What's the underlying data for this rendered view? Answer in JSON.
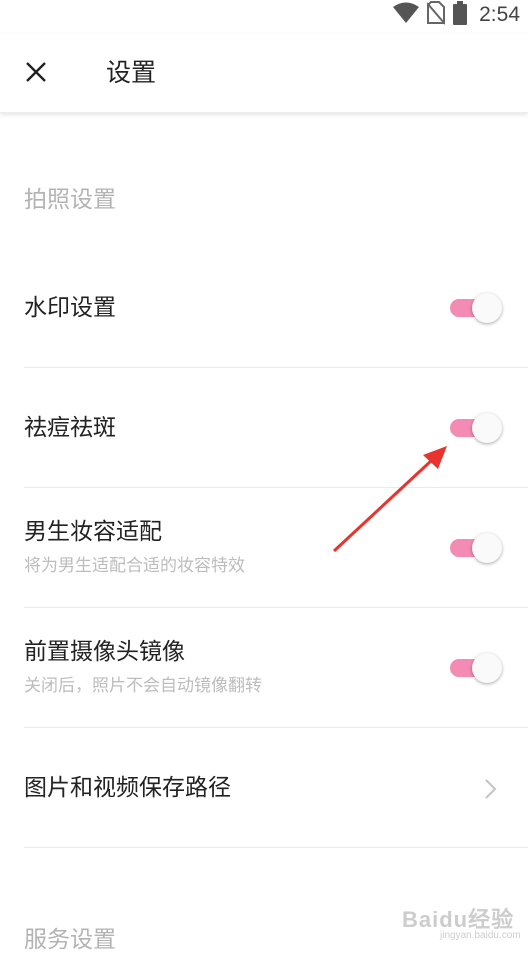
{
  "status_bar": {
    "time": "2:54",
    "icons": [
      "wifi-icon",
      "no-sim-icon",
      "battery-icon"
    ]
  },
  "app_bar": {
    "title": "设置",
    "close_icon": "close-icon"
  },
  "sections": {
    "photo": {
      "header": "拍照设置"
    },
    "service": {
      "header": "服务设置"
    }
  },
  "settings": [
    {
      "label": "水印设置",
      "sublabel": "",
      "type": "toggle",
      "on": true
    },
    {
      "label": "祛痘祛斑",
      "sublabel": "",
      "type": "toggle",
      "on": true
    },
    {
      "label": "男生妆容适配",
      "sublabel": "将为男生适配合适的妆容特效",
      "type": "toggle",
      "on": true
    },
    {
      "label": "前置摄像头镜像",
      "sublabel": "关闭后，照片不会自动镜像翻转",
      "type": "toggle",
      "on": true
    },
    {
      "label": "图片和视频保存路径",
      "sublabel": "",
      "type": "link",
      "icon": "chevron-right-icon"
    }
  ],
  "watermark": {
    "text": "Baidu经验",
    "sub": "jingyan.baidu.com"
  },
  "colors": {
    "toggle_track_on": "#f48bb4",
    "toggle_thumb": "#fafafa",
    "section_header": "#b3b3b3",
    "annotation_arrow": "#e8332f"
  }
}
